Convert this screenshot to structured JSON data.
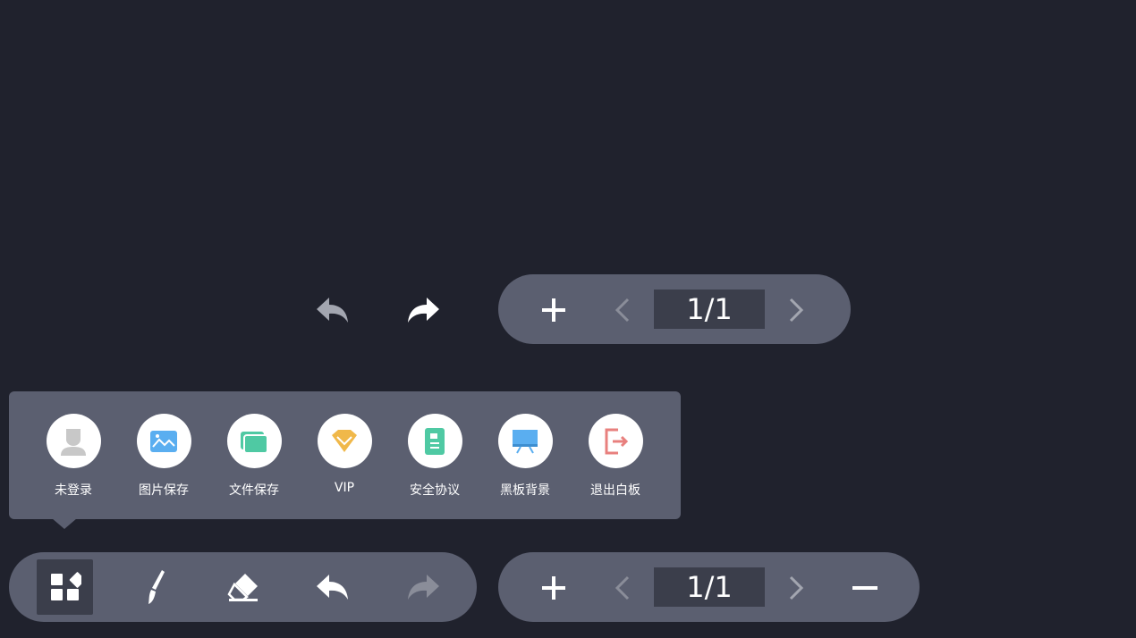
{
  "colors": {
    "background": "#20222d",
    "pill": "#5b5f70",
    "page_box": "#3b3e4b",
    "icon_active": "#ffffff",
    "icon_disabled": "#8a8d99"
  },
  "top_history": {
    "undo_icon": "undo-icon",
    "redo_icon": "redo-icon"
  },
  "top_pager": {
    "add_icon": "plus-icon",
    "prev_icon": "chevron-left-icon",
    "page_indicator": "1/1",
    "next_icon": "chevron-right-icon"
  },
  "menu": {
    "items": [
      {
        "label": "未登录",
        "icon": "user-icon",
        "color": "#c8c8c8"
      },
      {
        "label": "图片保存",
        "icon": "image-icon",
        "color": "#5aaef0"
      },
      {
        "label": "文件保存",
        "icon": "folder-icon",
        "color": "#4fc9a3"
      },
      {
        "label": "VIP",
        "icon": "diamond-icon",
        "color": "#f0b84a"
      },
      {
        "label": "安全协议",
        "icon": "document-icon",
        "color": "#4fc9a3"
      },
      {
        "label": "黑板背景",
        "icon": "blackboard-icon",
        "color": "#5aaef0"
      },
      {
        "label": "退出白板",
        "icon": "exit-icon",
        "color": "#e8807e"
      }
    ]
  },
  "toolbar": {
    "tools": [
      {
        "icon": "apps-grid-icon",
        "active": true
      },
      {
        "icon": "brush-icon",
        "active": false
      },
      {
        "icon": "eraser-icon",
        "active": false
      },
      {
        "icon": "undo-icon",
        "active": false
      },
      {
        "icon": "redo-icon",
        "disabled": true
      }
    ]
  },
  "bottom_pager": {
    "add_icon": "plus-icon",
    "prev_icon": "chevron-left-icon",
    "page_indicator": "1/1",
    "next_icon": "chevron-right-icon",
    "remove_icon": "minus-icon"
  }
}
